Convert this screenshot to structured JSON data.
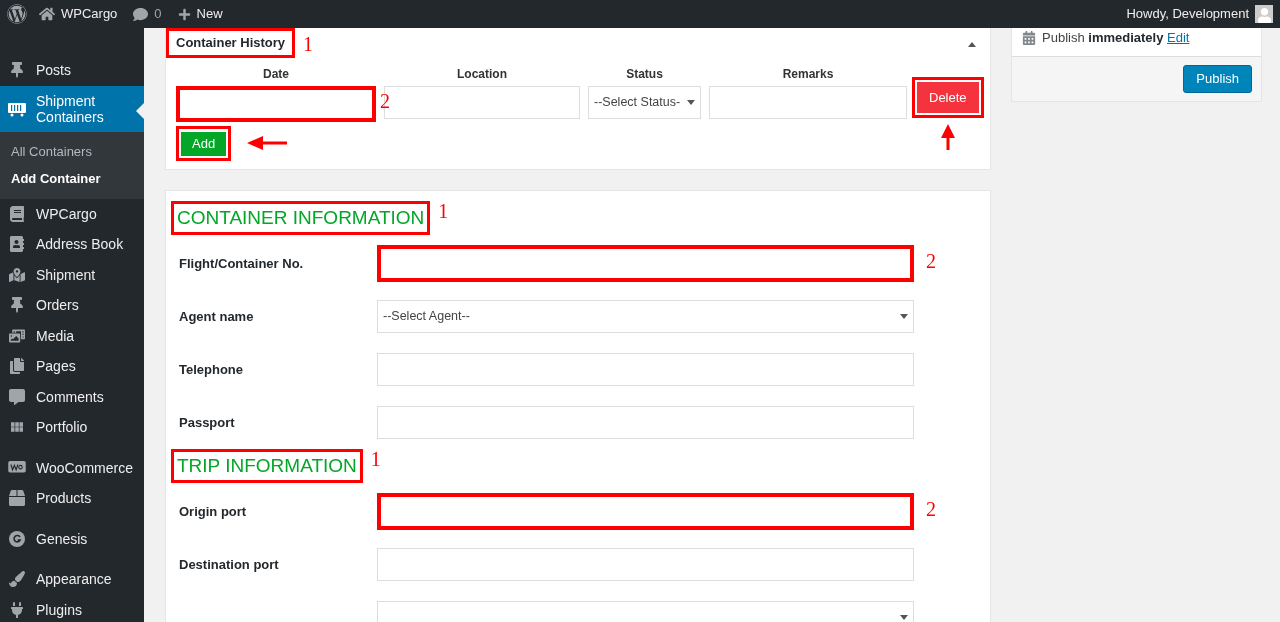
{
  "admin_bar": {
    "site": "WPCargo",
    "comments": "0",
    "new": "New",
    "greeting": "Howdy, Development"
  },
  "sidebar": {
    "groups": [
      [
        {
          "label": "Posts",
          "selected": false
        },
        {
          "label": "Shipment Containers",
          "selected": true,
          "children": [
            {
              "label": "All Containers",
              "selected": false
            },
            {
              "label": "Add Container",
              "selected": true
            }
          ]
        },
        {
          "label": "WPCargo",
          "selected": false
        },
        {
          "label": "Address Book",
          "selected": false
        },
        {
          "label": "Shipment",
          "selected": false
        },
        {
          "label": "Orders",
          "selected": false
        },
        {
          "label": "Media",
          "selected": false
        },
        {
          "label": "Pages",
          "selected": false
        },
        {
          "label": "Comments",
          "selected": false
        },
        {
          "label": "Portfolio",
          "selected": false
        }
      ],
      [
        {
          "label": "WooCommerce",
          "selected": false
        },
        {
          "label": "Products",
          "selected": false
        }
      ],
      [
        {
          "label": "Genesis",
          "selected": false
        }
      ],
      [
        {
          "label": "Appearance",
          "selected": false
        },
        {
          "label": "Plugins",
          "selected": false
        }
      ]
    ]
  },
  "container_history": {
    "title": "Container History",
    "highlighted": true,
    "callout": "1",
    "columns": [
      {
        "label": "Date",
        "kind": "input",
        "highlighted": true,
        "callout": "2"
      },
      {
        "label": "Location",
        "kind": "input",
        "highlighted": false
      },
      {
        "label": "Status",
        "kind": "select",
        "value": "--Select Status-",
        "highlighted": false
      },
      {
        "label": "Remarks",
        "kind": "input",
        "highlighted": false
      }
    ],
    "add_button": {
      "label": "Add",
      "highlighted": true,
      "arrow": true
    },
    "delete_button": {
      "label": "Delete",
      "highlighted": true,
      "arrow": true
    }
  },
  "form_sections": [
    {
      "title": "CONTAINER INFORMATION",
      "highlighted": true,
      "callout": "1",
      "rows": [
        {
          "label": "Flight/Container No.",
          "kind": "input",
          "highlighted": true,
          "callout": "2"
        },
        {
          "label": "Agent name",
          "kind": "select",
          "value": "--Select Agent--",
          "highlighted": false
        },
        {
          "label": "Telephone",
          "kind": "input",
          "highlighted": false
        },
        {
          "label": "Passport",
          "kind": "input",
          "highlighted": false
        }
      ]
    },
    {
      "title": "TRIP INFORMATION",
      "highlighted": true,
      "callout": "1",
      "rows": [
        {
          "label": "Origin port",
          "kind": "input",
          "highlighted": true,
          "callout": "2"
        },
        {
          "label": "Destination port",
          "kind": "input",
          "highlighted": false
        },
        {
          "kind": "select"
        }
      ]
    }
  ],
  "publish_box": {
    "status_label": "Publish",
    "status_value": "immediately",
    "edit_link": "Edit",
    "button": "Publish"
  }
}
